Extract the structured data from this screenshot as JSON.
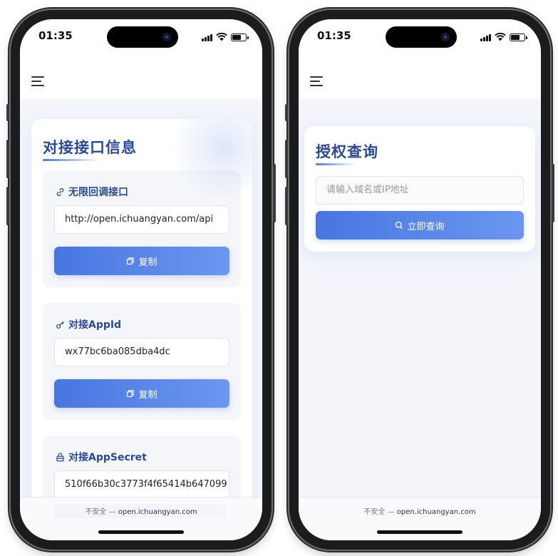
{
  "status": {
    "time": "01:35"
  },
  "left": {
    "section_title": "对接接口信息",
    "items": [
      {
        "label": "无限回调接口",
        "icon": "link-icon",
        "value": "http://open.ichuangyan.com/api",
        "button": "复制"
      },
      {
        "label": "对接AppId",
        "icon": "key-icon",
        "value": "wx77bc6ba085dba4dc",
        "button": "复制"
      },
      {
        "label": "对接AppSecret",
        "icon": "lock-icon",
        "value": "510f66b30c3773f4f65414b647099"
      }
    ]
  },
  "right": {
    "section_title": "授权查询",
    "search_placeholder": "请输入域名或IP地址",
    "search_button": "立即查询"
  },
  "urlbar": {
    "insecure": "不安全",
    "separator": "—",
    "domain": "open.ichuangyan.com"
  },
  "colors": {
    "accent": "#4776e0",
    "title": "#2c4a9a"
  }
}
